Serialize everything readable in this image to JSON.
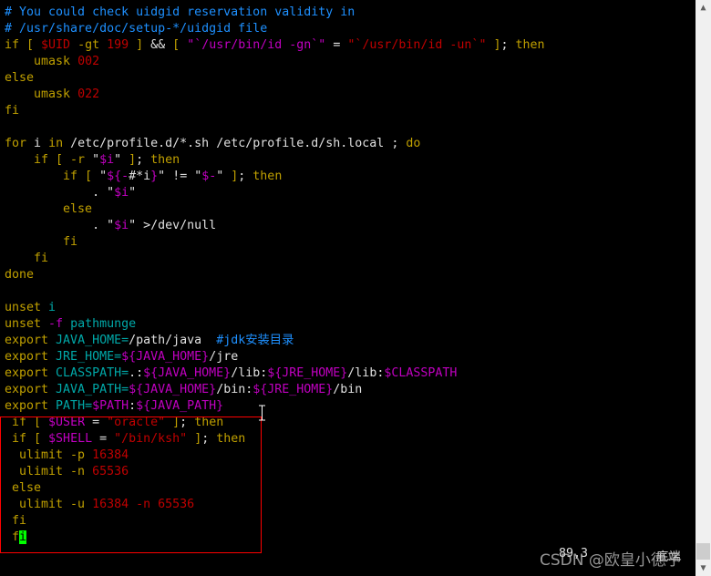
{
  "colors": {
    "keyword": "#c0a000",
    "identifier": "#00a8a8",
    "variable": "#c000c0",
    "string_number": "#c00000",
    "text": "#e0e0e0",
    "comment": "#1e90ff",
    "cursor": "#00ff00",
    "highlight_box": "#ff0000"
  },
  "lines": [
    [
      [
        "# You could check uidgid reservation validity in",
        "b"
      ]
    ],
    [
      [
        "# /usr/share/doc/setup-*/uidgid file",
        "b"
      ]
    ],
    [
      [
        "if [ ",
        "k"
      ],
      [
        "$UID",
        "r"
      ],
      [
        " -gt ",
        "k"
      ],
      [
        "199",
        "r"
      ],
      [
        " ] ",
        "k"
      ],
      [
        "&&",
        "w"
      ],
      [
        " [ ",
        "k"
      ],
      [
        "\"`/usr/bin/id -gn`\"",
        "m"
      ],
      [
        " = ",
        "w"
      ],
      [
        "\"`/usr/bin/id -un`\"",
        "r"
      ],
      [
        " ]",
        "k"
      ],
      [
        "; ",
        "w"
      ],
      [
        "then",
        "k"
      ]
    ],
    [
      [
        "    umask ",
        "k"
      ],
      [
        "002",
        "r"
      ]
    ],
    [
      [
        "else",
        "k"
      ]
    ],
    [
      [
        "    umask ",
        "k"
      ],
      [
        "022",
        "r"
      ]
    ],
    [
      [
        "fi",
        "k"
      ]
    ],
    [],
    [
      [
        "for",
        "k"
      ],
      [
        " i ",
        "w"
      ],
      [
        "in",
        "k"
      ],
      [
        " /etc/profile.d/*.sh /etc/profile.d/sh.local ; ",
        "w"
      ],
      [
        "do",
        "k"
      ]
    ],
    [
      [
        "    if [ -r ",
        "k"
      ],
      [
        "\"",
        "w"
      ],
      [
        "$i",
        "m"
      ],
      [
        "\"",
        "w"
      ],
      [
        " ]",
        "k"
      ],
      [
        "; ",
        "w"
      ],
      [
        "then",
        "k"
      ]
    ],
    [
      [
        "        if [ ",
        "k"
      ],
      [
        "\"",
        "w"
      ],
      [
        "${-",
        "m"
      ],
      [
        "#*i",
        "w"
      ],
      [
        "}",
        "m"
      ],
      [
        "\"",
        "w"
      ],
      [
        " != ",
        "w"
      ],
      [
        "\"",
        "w"
      ],
      [
        "$-",
        "m"
      ],
      [
        "\"",
        "w"
      ],
      [
        " ]",
        "k"
      ],
      [
        "; ",
        "w"
      ],
      [
        "then",
        "k"
      ]
    ],
    [
      [
        "            . ",
        "w"
      ],
      [
        "\"",
        "w"
      ],
      [
        "$i",
        "m"
      ],
      [
        "\"",
        "w"
      ]
    ],
    [
      [
        "        else",
        "k"
      ]
    ],
    [
      [
        "            . \"",
        "w"
      ],
      [
        "$i",
        "m"
      ],
      [
        "\" >/dev/null",
        "w"
      ]
    ],
    [
      [
        "        fi",
        "k"
      ]
    ],
    [
      [
        "    fi",
        "k"
      ]
    ],
    [
      [
        "done",
        "k"
      ]
    ],
    [],
    [
      [
        "unset",
        "k"
      ],
      [
        " i",
        "c"
      ]
    ],
    [
      [
        "unset ",
        "k"
      ],
      [
        "-f",
        "m"
      ],
      [
        " pathmunge",
        "c"
      ]
    ],
    [
      [
        "export ",
        "k"
      ],
      [
        "JAVA_HOME=",
        "c"
      ],
      [
        "/path/java  ",
        "w"
      ],
      [
        "#jdk安装目录",
        "b"
      ]
    ],
    [
      [
        "export ",
        "k"
      ],
      [
        "JRE_HOME=",
        "c"
      ],
      [
        "${JAVA_HOME}",
        "m"
      ],
      [
        "/jre",
        "w"
      ]
    ],
    [
      [
        "export ",
        "k"
      ],
      [
        "CLASSPATH=",
        "c"
      ],
      [
        ".:",
        "w"
      ],
      [
        "${JAVA_HOME}",
        "m"
      ],
      [
        "/lib:",
        "w"
      ],
      [
        "${JRE_HOME}",
        "m"
      ],
      [
        "/lib:",
        "w"
      ],
      [
        "$CLASSPATH",
        "m"
      ]
    ],
    [
      [
        "export ",
        "k"
      ],
      [
        "JAVA_PATH=",
        "c"
      ],
      [
        "${JAVA_HOME}",
        "m"
      ],
      [
        "/bin:",
        "w"
      ],
      [
        "${JRE_HOME}",
        "m"
      ],
      [
        "/bin",
        "w"
      ]
    ],
    [
      [
        "export ",
        "k"
      ],
      [
        "PATH=",
        "c"
      ],
      [
        "$PATH",
        "m"
      ],
      [
        ":",
        "w"
      ],
      [
        "${JAVA_PATH}",
        "m"
      ]
    ],
    [
      [
        " if [ ",
        "k"
      ],
      [
        "$USER",
        "m"
      ],
      [
        " = ",
        "w"
      ],
      [
        "\"oracle\"",
        "r"
      ],
      [
        " ]",
        "k"
      ],
      [
        "; ",
        "w"
      ],
      [
        "then",
        "k"
      ]
    ],
    [
      [
        " if [ ",
        "k"
      ],
      [
        "$SHELL",
        "m"
      ],
      [
        " = ",
        "w"
      ],
      [
        "\"/bin/ksh\"",
        "r"
      ],
      [
        " ]",
        "k"
      ],
      [
        "; ",
        "w"
      ],
      [
        "then",
        "k"
      ]
    ],
    [
      [
        "  ulimit -p ",
        "k"
      ],
      [
        "16384",
        "r"
      ]
    ],
    [
      [
        "  ulimit -n ",
        "k"
      ],
      [
        "65536",
        "r"
      ]
    ],
    [
      [
        " else",
        "k"
      ]
    ],
    [
      [
        "  ulimit -u ",
        "k"
      ],
      [
        "16384 -n 65536",
        "r"
      ]
    ],
    [
      [
        " fi",
        "k"
      ]
    ],
    [
      [
        " f",
        "k"
      ],
      [
        "i",
        "cursor"
      ]
    ]
  ],
  "status": {
    "position": "89,3",
    "where": "底端"
  },
  "watermark": "CSDN @欧皇小德子",
  "scrollbar": {
    "up_icon": "▲",
    "down_icon": "▼",
    "position_percent": 100
  }
}
